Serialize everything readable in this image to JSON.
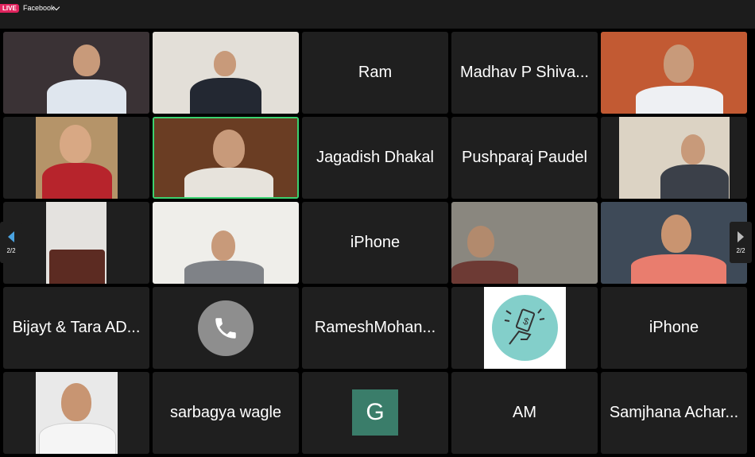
{
  "header": {
    "live_badge": "LIVE",
    "stream_target": "Facebook"
  },
  "tiles": [
    {
      "name": "participant-1"
    },
    {
      "name": "participant-2"
    },
    {
      "label": "Ram"
    },
    {
      "label": "Madhav P Shiva..."
    },
    {
      "name": "participant-5"
    },
    {
      "name": "participant-6"
    },
    {
      "name": "participant-7-speaking"
    },
    {
      "label": "Jagadish Dhakal"
    },
    {
      "label": "Pushparaj Paudel"
    },
    {
      "name": "participant-10"
    },
    {
      "name": "participant-11"
    },
    {
      "name": "participant-12"
    },
    {
      "label": "iPhone"
    },
    {
      "name": "participant-14"
    },
    {
      "name": "participant-15"
    },
    {
      "label": "Bijayt & Tara AD..."
    },
    {
      "name": "phone-caller"
    },
    {
      "label": "RameshMohan..."
    },
    {
      "name": "participant-19-avatar"
    },
    {
      "label": "iPhone"
    },
    {
      "name": "participant-21"
    },
    {
      "label": "sarbagya wagle"
    },
    {
      "avatar_letter": "G"
    },
    {
      "label": "AM"
    },
    {
      "label": "Samjhana Achar..."
    }
  ],
  "pagination": {
    "left_page": "2/2",
    "right_page": "2/2"
  },
  "colors": {
    "tile_bg": "#1f1f1f",
    "active_speaker": "#3bd16f",
    "live_red": "#e0245e",
    "nav_prev": "#4aa3e0"
  }
}
